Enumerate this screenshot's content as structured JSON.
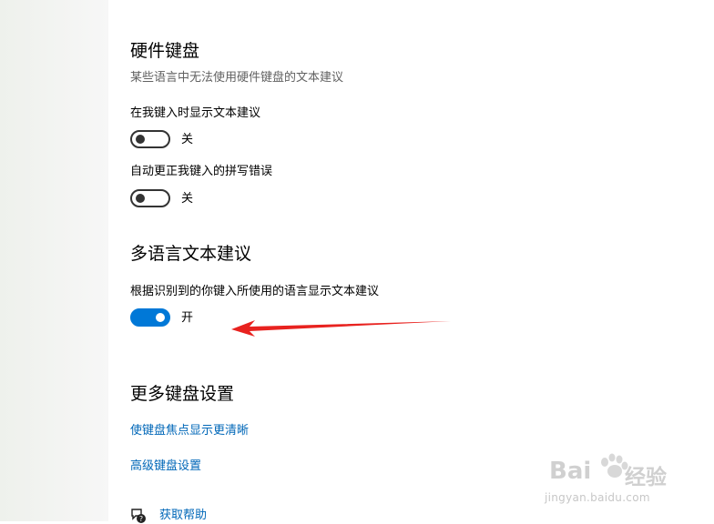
{
  "hardware_keyboard": {
    "heading": "硬件键盘",
    "description": "某些语言中无法使用硬件键盘的文本建议",
    "show_suggestions": {
      "label": "在我键入时显示文本建议",
      "state_text": "关",
      "on": false
    },
    "autocorrect": {
      "label": "自动更正我键入的拼写错误",
      "state_text": "关",
      "on": false
    }
  },
  "multilingual": {
    "heading": "多语言文本建议",
    "setting": {
      "label": "根据识别到的你键入所使用的语言显示文本建议",
      "state_text": "开",
      "on": true
    }
  },
  "more_keyboard": {
    "heading": "更多键盘设置",
    "links": [
      "使键盘焦点显示更清晰",
      "高级键盘设置"
    ]
  },
  "help": {
    "label": "获取帮助"
  },
  "watermark": {
    "brand": "Bai",
    "brand_suffix": "经验",
    "url": "jingyan.baidu.com"
  },
  "annotation": {
    "arrow_color": "#e8221f"
  },
  "colors": {
    "accent": "#0078d7",
    "link": "#0067b8"
  }
}
